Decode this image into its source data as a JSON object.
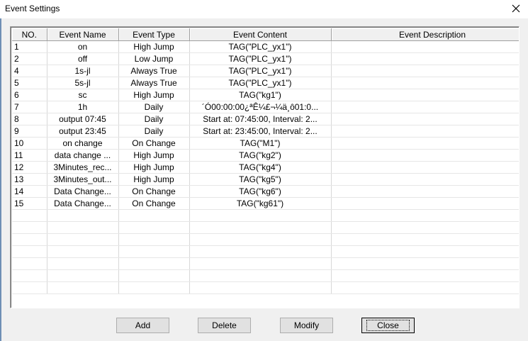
{
  "window": {
    "title": "Event Settings",
    "close_icon": "close-icon"
  },
  "table": {
    "columns": [
      "NO.",
      "Event Name",
      "Event Type",
      "Event Content",
      "Event Description"
    ],
    "rows": [
      {
        "no": "1",
        "name": "on",
        "type": "High Jump",
        "content": "TAG(\"PLC_yx1\")",
        "description": ""
      },
      {
        "no": "2",
        "name": "off",
        "type": "Low Jump",
        "content": "TAG(\"PLC_yx1\")",
        "description": ""
      },
      {
        "no": "4",
        "name": "1s-jl",
        "type": "Always True",
        "content": "TAG(\"PLC_yx1\")",
        "description": ""
      },
      {
        "no": "5",
        "name": "5s-jl",
        "type": "Always True",
        "content": "TAG(\"PLC_yx1\")",
        "description": ""
      },
      {
        "no": "6",
        "name": "sc",
        "type": "High Jump",
        "content": "TAG(\"kg1\")",
        "description": ""
      },
      {
        "no": "7",
        "name": "1h",
        "type": "Daily",
        "content": "´Ó00:00:00¿ªÊ¼£¬¼ä¸ô01:0...",
        "description": ""
      },
      {
        "no": "8",
        "name": "output 07:45",
        "type": "Daily",
        "content": "Start at: 07:45:00, Interval: 2...",
        "description": ""
      },
      {
        "no": "9",
        "name": "output 23:45",
        "type": "Daily",
        "content": "Start at: 23:45:00, Interval: 2...",
        "description": ""
      },
      {
        "no": "10",
        "name": "on change",
        "type": "On Change",
        "content": "TAG(\"M1\")",
        "description": ""
      },
      {
        "no": "11",
        "name": "data change ...",
        "type": "High Jump",
        "content": "TAG(\"kg2\")",
        "description": ""
      },
      {
        "no": "12",
        "name": "3Minutes_rec...",
        "type": "High Jump",
        "content": "TAG(\"kg4\")",
        "description": ""
      },
      {
        "no": "13",
        "name": "3Minutes_out...",
        "type": "High Jump",
        "content": "TAG(\"kg5\")",
        "description": ""
      },
      {
        "no": "14",
        "name": "Data Change...",
        "type": "On Change",
        "content": "TAG(\"kg6\")",
        "description": ""
      },
      {
        "no": "15",
        "name": "Data Change...",
        "type": "On Change",
        "content": "TAG(\"kg61\")",
        "description": ""
      }
    ],
    "empty_rows": 7
  },
  "buttons": {
    "add": "Add",
    "delete": "Delete",
    "modify": "Modify",
    "close": "Close"
  }
}
